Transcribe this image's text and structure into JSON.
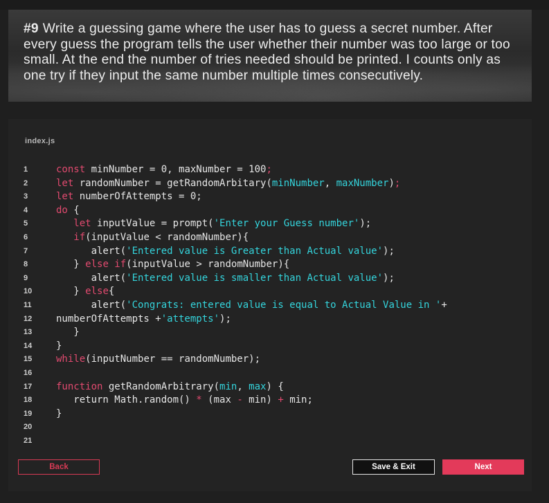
{
  "question": {
    "number": "#9",
    "text": "Write a guessing game where the user has to guess a secret number. After every guess the program tells the user whether their number was too large or too small. At the end the number of tries needed should be printed. I counts only as one try if they input the same number multiple times consecutively."
  },
  "editor": {
    "filename": "index.js",
    "line_numbers": [
      "1",
      "2",
      "3",
      "4",
      "5",
      "6",
      "7",
      "8",
      "9",
      "10",
      "11",
      "12",
      "13",
      "14",
      "15",
      "16",
      "17",
      "18",
      "19",
      "20",
      "21"
    ]
  },
  "buttons": {
    "back": "Back",
    "save_exit": "Save & Exit",
    "next": "Next"
  },
  "colors": {
    "accent": "#e33a5a",
    "string": "#34d4dc",
    "keyword": "#e14a6f",
    "background": "#1f1f1f"
  }
}
